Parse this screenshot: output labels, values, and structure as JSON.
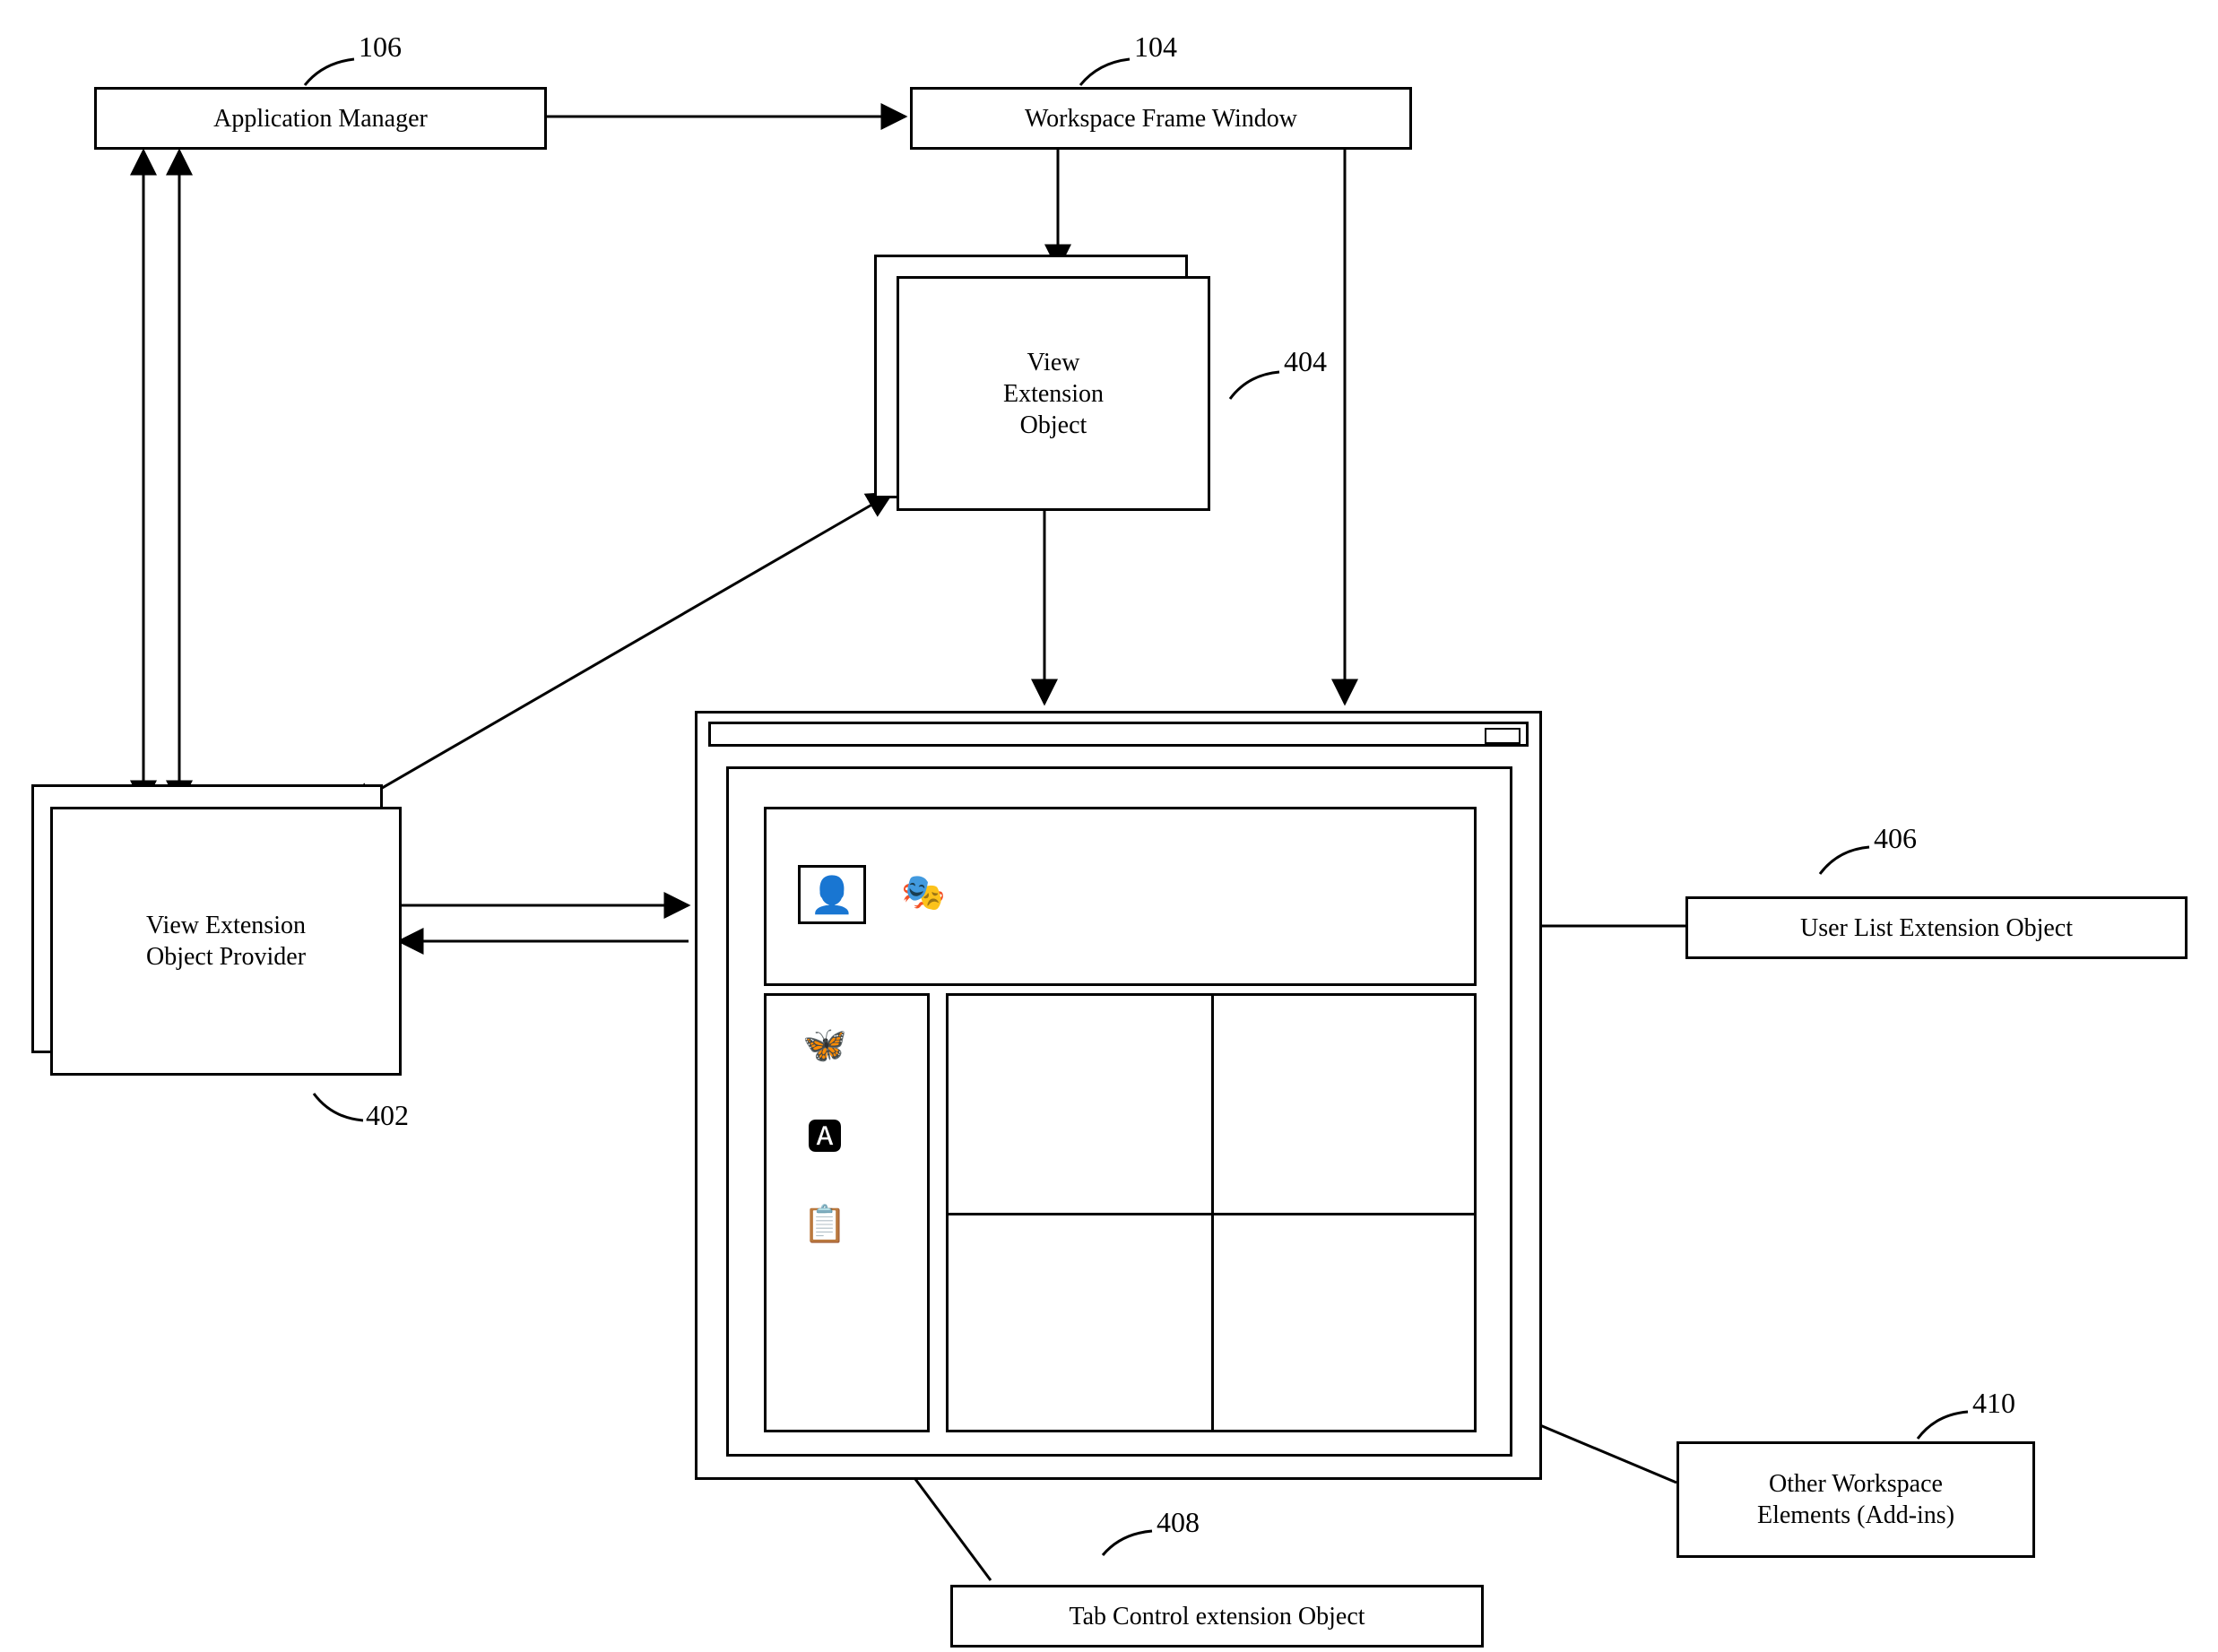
{
  "nodes": {
    "app_manager": {
      "label": "Application Manager",
      "ref": "106"
    },
    "workspace_frame": {
      "label": "Workspace Frame Window",
      "ref": "104"
    },
    "view_ext_obj": {
      "label": "View\nExtension\nObject",
      "ref": "404"
    },
    "view_ext_provider": {
      "label": "View Extension\nObject Provider",
      "ref": "402"
    },
    "user_list_ext": {
      "label": "User List Extension Object",
      "ref": "406"
    },
    "tab_ctrl_ext": {
      "label": "Tab Control  extension Object",
      "ref": "408"
    },
    "other_elems": {
      "label": "Other Workspace\nElements (Add-ins)",
      "ref": "410"
    }
  },
  "icons": {
    "user1": "👤",
    "user2": "🎭",
    "tab1": "🦋",
    "tab2": "🅰",
    "tab3": "📋"
  }
}
